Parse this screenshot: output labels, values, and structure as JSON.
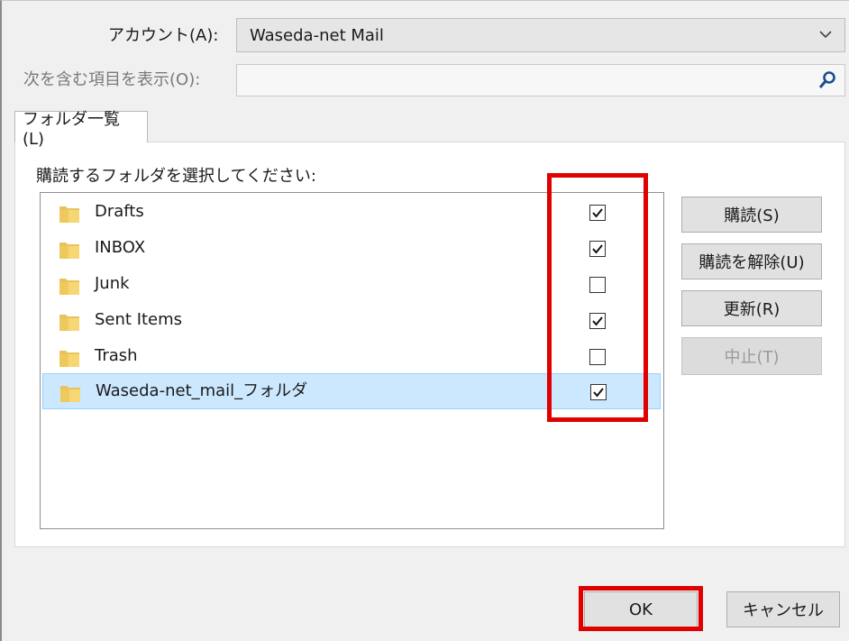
{
  "account": {
    "label": "アカウント(A):",
    "value": "Waseda-net Mail"
  },
  "filter": {
    "label": "次を含む項目を表示(O):",
    "value": ""
  },
  "tab": {
    "label": "フォルダ一覧(L)"
  },
  "list": {
    "heading": "購読するフォルダを選択してください:",
    "items": [
      {
        "name": "Drafts",
        "checked": true
      },
      {
        "name": "INBOX",
        "checked": true
      },
      {
        "name": "Junk",
        "checked": false
      },
      {
        "name": "Sent Items",
        "checked": true
      },
      {
        "name": "Trash",
        "checked": false
      },
      {
        "name": "Waseda-net_mail_フォルダ",
        "checked": true,
        "selected": true
      }
    ]
  },
  "side_buttons": {
    "subscribe": "購読(S)",
    "unsubscribe": "購読を解除(U)",
    "refresh": "更新(R)",
    "stop": "中止(T)"
  },
  "footer": {
    "ok": "OK",
    "cancel": "キャンセル"
  },
  "colors": {
    "highlight": "#e00000",
    "selection": "#cce8ff"
  },
  "icons": {
    "folder": "folder-icon",
    "dropdown": "chevron-down-icon",
    "search": "search-icon",
    "check": "checkmark-icon"
  }
}
